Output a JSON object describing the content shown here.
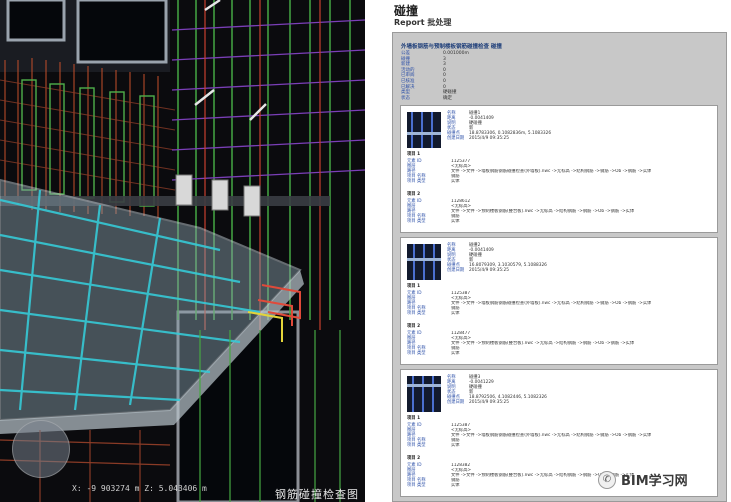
{
  "viewport": {
    "coords": "X: -9 903274 m  Z: 5.043406 m",
    "caption": "钢筋碰撞检查图"
  },
  "report": {
    "title": "碰撞",
    "subtitle": "Report 批处理",
    "frame_title": "外墙板钢筋与预制楼板钢筋碰撞检查 碰撞",
    "summary": [
      {
        "k": "公差",
        "v": "0.001000m"
      },
      {
        "k": "碰撞",
        "v": "3"
      },
      {
        "k": "新建",
        "v": "3"
      },
      {
        "k": "活动的",
        "v": "0"
      },
      {
        "k": "已审阅",
        "v": "0"
      },
      {
        "k": "已核准",
        "v": "0"
      },
      {
        "k": "已解决",
        "v": "0"
      },
      {
        "k": "类型",
        "v": "硬碰撞"
      },
      {
        "k": "状态",
        "v": "确定"
      }
    ],
    "clashes": [
      {
        "info": [
          {
            "k": "名称",
            "v": "碰撞1"
          },
          {
            "k": "距离",
            "v": "-0.0041409"
          },
          {
            "k": "说明",
            "v": "硬碰撞"
          },
          {
            "k": "状态",
            "v": "新"
          },
          {
            "k": "碰撞点",
            "v": "18.8783306, 0.1082836m, 5.1083326"
          },
          {
            "k": "创建日期",
            "v": "2015/4/9 09:35:25"
          }
        ],
        "items": [
          {
            "title": "项目 1",
            "rows": [
              {
                "k": "元素 ID",
                "v": "1125377"
              },
              {
                "k": "图层",
                "v": "<无标高>"
              },
              {
                "k": "路径",
                "v": "文件 ->文件 ->墙板钢筋钢筋碰撞检查(外墙板).nwc ->无标高 ->结构钢筋 ->钢筋 ->Ob ->钢筋 ->实体"
              },
              {
                "k": "项目 名称",
                "v": "钢筋"
              },
              {
                "k": "项目 类型",
                "v": "实体"
              }
            ]
          },
          {
            "title": "项目 2",
            "rows": [
              {
                "k": "元素 ID",
                "v": "1128612"
              },
              {
                "k": "图层",
                "v": "<无标高>"
              },
              {
                "k": "路径",
                "v": "文件 ->文件 ->预制楼板钢筋(叠合板).nwc ->无标高 ->结构钢筋 ->钢筋 ->Ob ->钢筋 ->实体"
              },
              {
                "k": "项目 名称",
                "v": "钢筋"
              },
              {
                "k": "项目 类型",
                "v": "实体"
              }
            ]
          }
        ]
      },
      {
        "info": [
          {
            "k": "名称",
            "v": "碰撞2"
          },
          {
            "k": "距离",
            "v": "-0.0041409"
          },
          {
            "k": "说明",
            "v": "硬碰撞"
          },
          {
            "k": "状态",
            "v": "新"
          },
          {
            "k": "碰撞点",
            "v": "16.8079309, 3.1030579, 5.1088326"
          },
          {
            "k": "创建日期",
            "v": "2015/4/9 09:35:25"
          }
        ],
        "items": [
          {
            "title": "项目 1",
            "rows": [
              {
                "k": "元素 ID",
                "v": "1125387"
              },
              {
                "k": "图层",
                "v": "<无标高>"
              },
              {
                "k": "路径",
                "v": "文件 ->文件 ->墙板钢筋钢筋碰撞检查(外墙板).nwc ->无标高 ->结构钢筋 ->钢筋 ->Ob ->钢筋 ->实体"
              },
              {
                "k": "项目 名称",
                "v": "钢筋"
              },
              {
                "k": "项目 类型",
                "v": "实体"
              }
            ]
          },
          {
            "title": "项目 2",
            "rows": [
              {
                "k": "元素 ID",
                "v": "1128477"
              },
              {
                "k": "图层",
                "v": "<无标高>"
              },
              {
                "k": "路径",
                "v": "文件 ->文件 ->预制楼板钢筋(叠合板).nwc ->无标高 ->结构钢筋 ->钢筋 ->Ob ->钢筋 ->实体"
              },
              {
                "k": "项目 名称",
                "v": "钢筋"
              },
              {
                "k": "项目 类型",
                "v": "实体"
              }
            ]
          }
        ]
      },
      {
        "info": [
          {
            "k": "名称",
            "v": "碰撞3"
          },
          {
            "k": "距离",
            "v": "-0.0041229"
          },
          {
            "k": "说明",
            "v": "硬碰撞"
          },
          {
            "k": "状态",
            "v": "新"
          },
          {
            "k": "碰撞点",
            "v": "18.8792506, 4.1082446, 5.1082326"
          },
          {
            "k": "创建日期",
            "v": "2015/4/9 09:35:25"
          }
        ],
        "items": [
          {
            "title": "项目 1",
            "rows": [
              {
                "k": "元素 ID",
                "v": "1125387"
              },
              {
                "k": "图层",
                "v": "<无标高>"
              },
              {
                "k": "路径",
                "v": "文件 ->文件 ->墙板钢筋钢筋碰撞检查(外墙板).nwc ->无标高 ->结构钢筋 ->钢筋 ->Ob ->钢筋 ->实体"
              },
              {
                "k": "项目 名称",
                "v": "钢筋"
              },
              {
                "k": "项目 类型",
                "v": "实体"
              }
            ]
          },
          {
            "title": "项目 2",
            "rows": [
              {
                "k": "元素 ID",
                "v": "1128382"
              },
              {
                "k": "图层",
                "v": "<无标高>"
              },
              {
                "k": "路径",
                "v": "文件 ->文件 ->预制楼板钢筋(叠合板).nwc ->无标高 ->结构钢筋 ->钢筋 ->Ob ->钢筋 ->实体"
              },
              {
                "k": "项目 名称",
                "v": "钢筋"
              },
              {
                "k": "项目 类型",
                "v": "实体"
              }
            ]
          }
        ]
      }
    ]
  },
  "watermark": {
    "text": "BIM学习网",
    "icon": "wechat-icon"
  }
}
